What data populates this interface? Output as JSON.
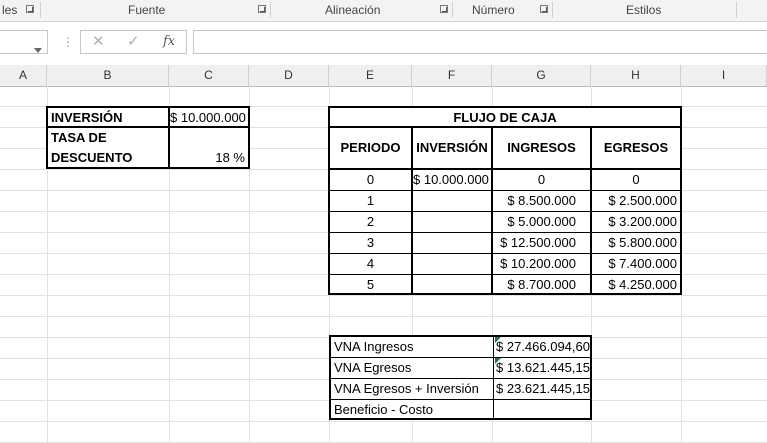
{
  "ribbon": {
    "groups": [
      {
        "label": "les"
      },
      {
        "label": "Fuente"
      },
      {
        "label": "Alineación"
      },
      {
        "label": "Número"
      },
      {
        "label": "Estilos"
      }
    ]
  },
  "formula_bar": {
    "cancel_glyph": "✕",
    "enter_glyph": "✓",
    "fx_label": "fx",
    "value": ""
  },
  "columns": [
    "A",
    "B",
    "C",
    "D",
    "E",
    "F",
    "G",
    "H",
    "I"
  ],
  "inputs": {
    "inversion_label": "INVERSIÓN",
    "inversion_value": "$ 10.000.000",
    "tasa_label_line1": "TASA DE",
    "tasa_label_line2": "DESCUENTO",
    "tasa_value": "18 %"
  },
  "cash_flow": {
    "title": "FLUJO DE CAJA",
    "headers": [
      "PERIODO",
      "INVERSIÓN",
      "INGRESOS",
      "EGRESOS"
    ],
    "rows": [
      {
        "periodo": "0",
        "inversion": "$ 10.000.000",
        "ingresos": "0",
        "egresos": "0"
      },
      {
        "periodo": "1",
        "inversion": "",
        "ingresos": "$ 8.500.000",
        "egresos": "$ 2.500.000"
      },
      {
        "periodo": "2",
        "inversion": "",
        "ingresos": "$ 5.000.000",
        "egresos": "$ 3.200.000"
      },
      {
        "periodo": "3",
        "inversion": "",
        "ingresos": "$ 12.500.000",
        "egresos": "$ 5.800.000"
      },
      {
        "periodo": "4",
        "inversion": "",
        "ingresos": "$ 10.200.000",
        "egresos": "$ 7.400.000"
      },
      {
        "periodo": "5",
        "inversion": "",
        "ingresos": "$ 8.700.000",
        "egresos": "$ 4.250.000"
      }
    ]
  },
  "results": [
    {
      "label": "VNA Ingresos",
      "value": "$ 27.466.094,60"
    },
    {
      "label": "VNA Egresos",
      "value": "$ 13.621.445,15"
    },
    {
      "label": "VNA Egresos + Inversión",
      "value": "$ 23.621.445,15"
    },
    {
      "label": "Beneficio - Costo",
      "value": ""
    }
  ],
  "colors": {
    "header_bg": "#efefef",
    "gridline": "#e1e1e1",
    "error_indicator": "#1e7b3a"
  }
}
